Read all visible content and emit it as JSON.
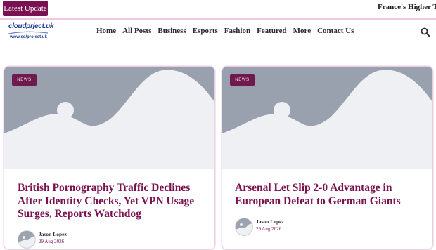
{
  "ticker": {
    "badge": "Latest Update",
    "headline": "France's Higher Tri"
  },
  "header": {
    "logo_brand": "cloudprject.uk",
    "logo_domain": "www.so/project.uk",
    "nav": [
      "Home",
      "All Posts",
      "Business",
      "Esports",
      "Fashion",
      "Featured",
      "More",
      "Contact Us"
    ],
    "search_icon": "search-icon"
  },
  "colors": {
    "accent": "#7a1150",
    "tag_bg": "#6e1a4e",
    "placeholder_bg": "#98a1ad",
    "placeholder_fg": "#eef0f3",
    "card_border": "#e8cfe0"
  },
  "posts": [
    {
      "tag": "NEWS",
      "title": "British Pornography Traffic Declines After Identity Checks, Yet VPN Usage Surges, Reports Watchdog",
      "author": "Jason Lopez",
      "date": "29 Aug 2026"
    },
    {
      "tag": "NEWS",
      "title": "Arsenal Let Slip 2-0 Advantage in European Defeat to German Giants",
      "author": "Jason Lopez",
      "date": "29 Aug 2026"
    }
  ]
}
